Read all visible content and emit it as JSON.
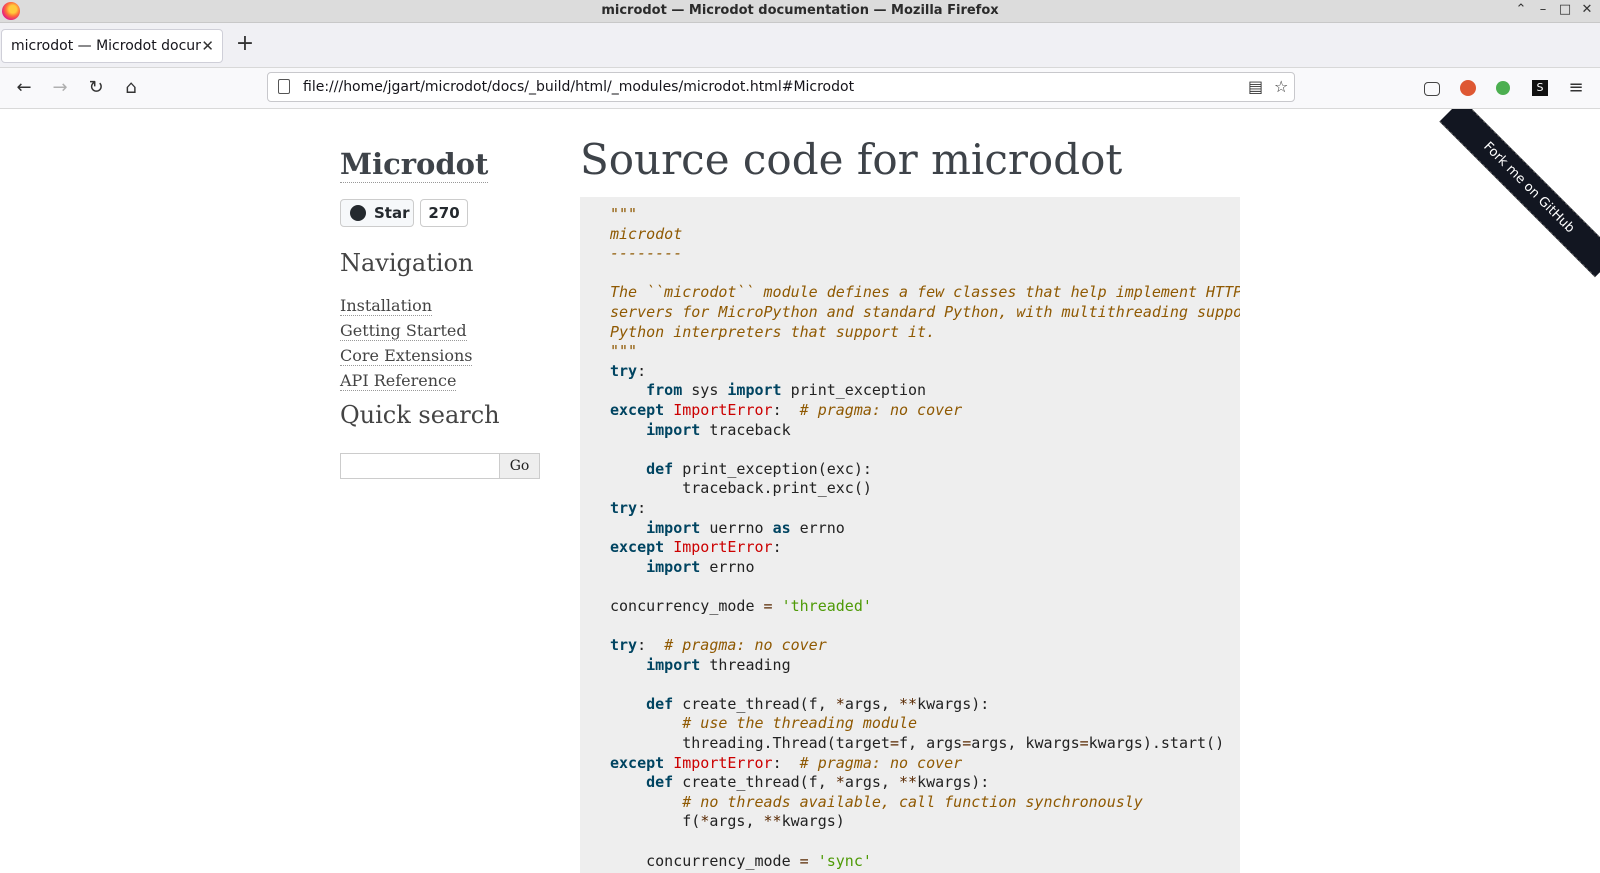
{
  "window": {
    "title": "microdot — Microdot documentation — Mozilla Firefox",
    "controls": [
      "⌃",
      "–",
      "□",
      "✕"
    ]
  },
  "tabs": [
    {
      "label": "microdot — Microdot documentation",
      "close": "✕"
    }
  ],
  "new_tab_label": "+",
  "nav": {
    "back_icon": "←",
    "forward_icon": "→",
    "reload_icon": "↻",
    "home_icon": "⌂",
    "url": "file:///home/jgart/microdot/docs/_build/html/_modules/microdot.html#Microdot",
    "reader_icon": "▤",
    "bookmark_icon": "☆",
    "menu_icon": "≡"
  },
  "sidebar": {
    "logo": "Microdot",
    "star_label": "Star",
    "star_count": "270",
    "navigation_heading": "Navigation",
    "nav_items": [
      "Installation",
      "Getting Started",
      "Core Extensions",
      "API Reference"
    ],
    "quick_search_heading": "Quick search",
    "search_value": "",
    "go_label": "Go"
  },
  "main": {
    "title": "Source code for microdot"
  },
  "ribbon_text": "Fork me on GitHub",
  "colors": {
    "code_bg": "#eeeeee",
    "keyword": "#004461",
    "exception": "#cc0000",
    "docstring": "#8f5902",
    "string": "#4e9a06"
  },
  "code_lines": [
    [
      {
        "t": "\"\"\"",
        "c": "doc"
      }
    ],
    [
      {
        "t": "microdot",
        "c": "doc"
      }
    ],
    [
      {
        "t": "--------",
        "c": "doc"
      }
    ],
    [],
    [
      {
        "t": "The ``microdot`` module defines a few classes that help implement HTTP-based",
        "c": "doc"
      }
    ],
    [
      {
        "t": "servers for MicroPython and standard Python, with multithreading support for",
        "c": "doc"
      }
    ],
    [
      {
        "t": "Python interpreters that support it.",
        "c": "doc"
      }
    ],
    [
      {
        "t": "\"\"\"",
        "c": "doc"
      }
    ],
    [
      {
        "t": "try",
        "c": "kw"
      },
      {
        "t": ":",
        "c": ""
      }
    ],
    [
      {
        "t": "    ",
        "c": ""
      },
      {
        "t": "from",
        "c": "kw"
      },
      {
        "t": " sys ",
        "c": ""
      },
      {
        "t": "import",
        "c": "kw"
      },
      {
        "t": " print_exception",
        "c": ""
      }
    ],
    [
      {
        "t": "except",
        "c": "kw"
      },
      {
        "t": " ",
        "c": ""
      },
      {
        "t": "ImportError",
        "c": "ex"
      },
      {
        "t": ":  ",
        "c": ""
      },
      {
        "t": "# pragma: no cover",
        "c": "cm"
      }
    ],
    [
      {
        "t": "    ",
        "c": ""
      },
      {
        "t": "import",
        "c": "kw"
      },
      {
        "t": " traceback",
        "c": ""
      }
    ],
    [],
    [
      {
        "t": "    ",
        "c": ""
      },
      {
        "t": "def",
        "c": "kw"
      },
      {
        "t": " print_exception(exc):",
        "c": ""
      }
    ],
    [
      {
        "t": "        traceback.print_exc()",
        "c": ""
      }
    ],
    [
      {
        "t": "try",
        "c": "kw"
      },
      {
        "t": ":",
        "c": ""
      }
    ],
    [
      {
        "t": "    ",
        "c": ""
      },
      {
        "t": "import",
        "c": "kw"
      },
      {
        "t": " uerrno ",
        "c": ""
      },
      {
        "t": "as",
        "c": "kw"
      },
      {
        "t": " errno",
        "c": ""
      }
    ],
    [
      {
        "t": "except",
        "c": "kw"
      },
      {
        "t": " ",
        "c": ""
      },
      {
        "t": "ImportError",
        "c": "ex"
      },
      {
        "t": ":",
        "c": ""
      }
    ],
    [
      {
        "t": "    ",
        "c": ""
      },
      {
        "t": "import",
        "c": "kw"
      },
      {
        "t": " errno",
        "c": ""
      }
    ],
    [],
    [
      {
        "t": "concurrency_mode ",
        "c": ""
      },
      {
        "t": "=",
        "c": "op"
      },
      {
        "t": " ",
        "c": ""
      },
      {
        "t": "'threaded'",
        "c": "st"
      }
    ],
    [],
    [
      {
        "t": "try",
        "c": "kw"
      },
      {
        "t": ":  ",
        "c": ""
      },
      {
        "t": "# pragma: no cover",
        "c": "cm"
      }
    ],
    [
      {
        "t": "    ",
        "c": ""
      },
      {
        "t": "import",
        "c": "kw"
      },
      {
        "t": " threading",
        "c": ""
      }
    ],
    [],
    [
      {
        "t": "    ",
        "c": ""
      },
      {
        "t": "def",
        "c": "kw"
      },
      {
        "t": " create_thread(f, ",
        "c": ""
      },
      {
        "t": "*",
        "c": "op"
      },
      {
        "t": "args, ",
        "c": ""
      },
      {
        "t": "**",
        "c": "op"
      },
      {
        "t": "kwargs):",
        "c": ""
      }
    ],
    [
      {
        "t": "        ",
        "c": ""
      },
      {
        "t": "# use the threading module",
        "c": "cm"
      }
    ],
    [
      {
        "t": "        threading.Thread(target",
        "c": ""
      },
      {
        "t": "=",
        "c": "op"
      },
      {
        "t": "f, args",
        "c": ""
      },
      {
        "t": "=",
        "c": "op"
      },
      {
        "t": "args, kwargs",
        "c": ""
      },
      {
        "t": "=",
        "c": "op"
      },
      {
        "t": "kwargs).start()",
        "c": ""
      }
    ],
    [
      {
        "t": "except",
        "c": "kw"
      },
      {
        "t": " ",
        "c": ""
      },
      {
        "t": "ImportError",
        "c": "ex"
      },
      {
        "t": ":  ",
        "c": ""
      },
      {
        "t": "# pragma: no cover",
        "c": "cm"
      }
    ],
    [
      {
        "t": "    ",
        "c": ""
      },
      {
        "t": "def",
        "c": "kw"
      },
      {
        "t": " create_thread(f, ",
        "c": ""
      },
      {
        "t": "*",
        "c": "op"
      },
      {
        "t": "args, ",
        "c": ""
      },
      {
        "t": "**",
        "c": "op"
      },
      {
        "t": "kwargs):",
        "c": ""
      }
    ],
    [
      {
        "t": "        ",
        "c": ""
      },
      {
        "t": "# no threads available, call function synchronously",
        "c": "cm"
      }
    ],
    [
      {
        "t": "        f(",
        "c": ""
      },
      {
        "t": "*",
        "c": "op"
      },
      {
        "t": "args, ",
        "c": ""
      },
      {
        "t": "**",
        "c": "op"
      },
      {
        "t": "kwargs)",
        "c": ""
      }
    ],
    [],
    [
      {
        "t": "    concurrency_mode ",
        "c": ""
      },
      {
        "t": "=",
        "c": "op"
      },
      {
        "t": " ",
        "c": ""
      },
      {
        "t": "'sync'",
        "c": "st"
      }
    ]
  ]
}
